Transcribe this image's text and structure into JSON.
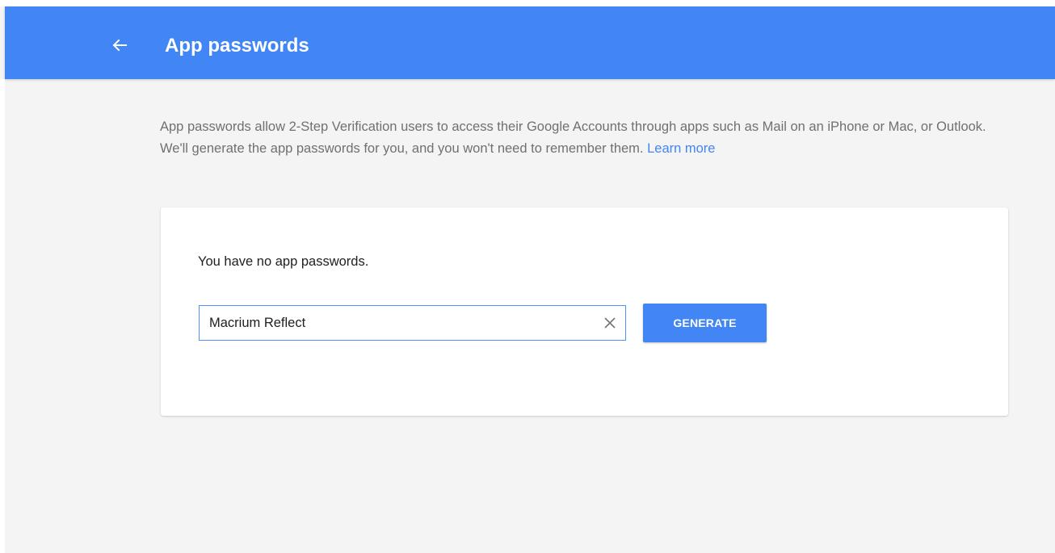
{
  "header": {
    "title": "App passwords",
    "back_icon": "arrow-back-icon",
    "background_color": "#4285f4"
  },
  "description": {
    "text": "App passwords allow 2-Step Verification users to access their Google Accounts through apps such as Mail on an iPhone or Mac, or Outlook. We'll generate the app passwords for you, and you won't need to remember them. ",
    "link_label": "Learn more",
    "link_color": "#4285f4"
  },
  "card": {
    "status_text": "You have no app passwords.",
    "input": {
      "value": "Macrium Reflect",
      "clear_icon": "close-icon",
      "border_color": "#4d90fe"
    },
    "generate_label": "GENERATE"
  }
}
